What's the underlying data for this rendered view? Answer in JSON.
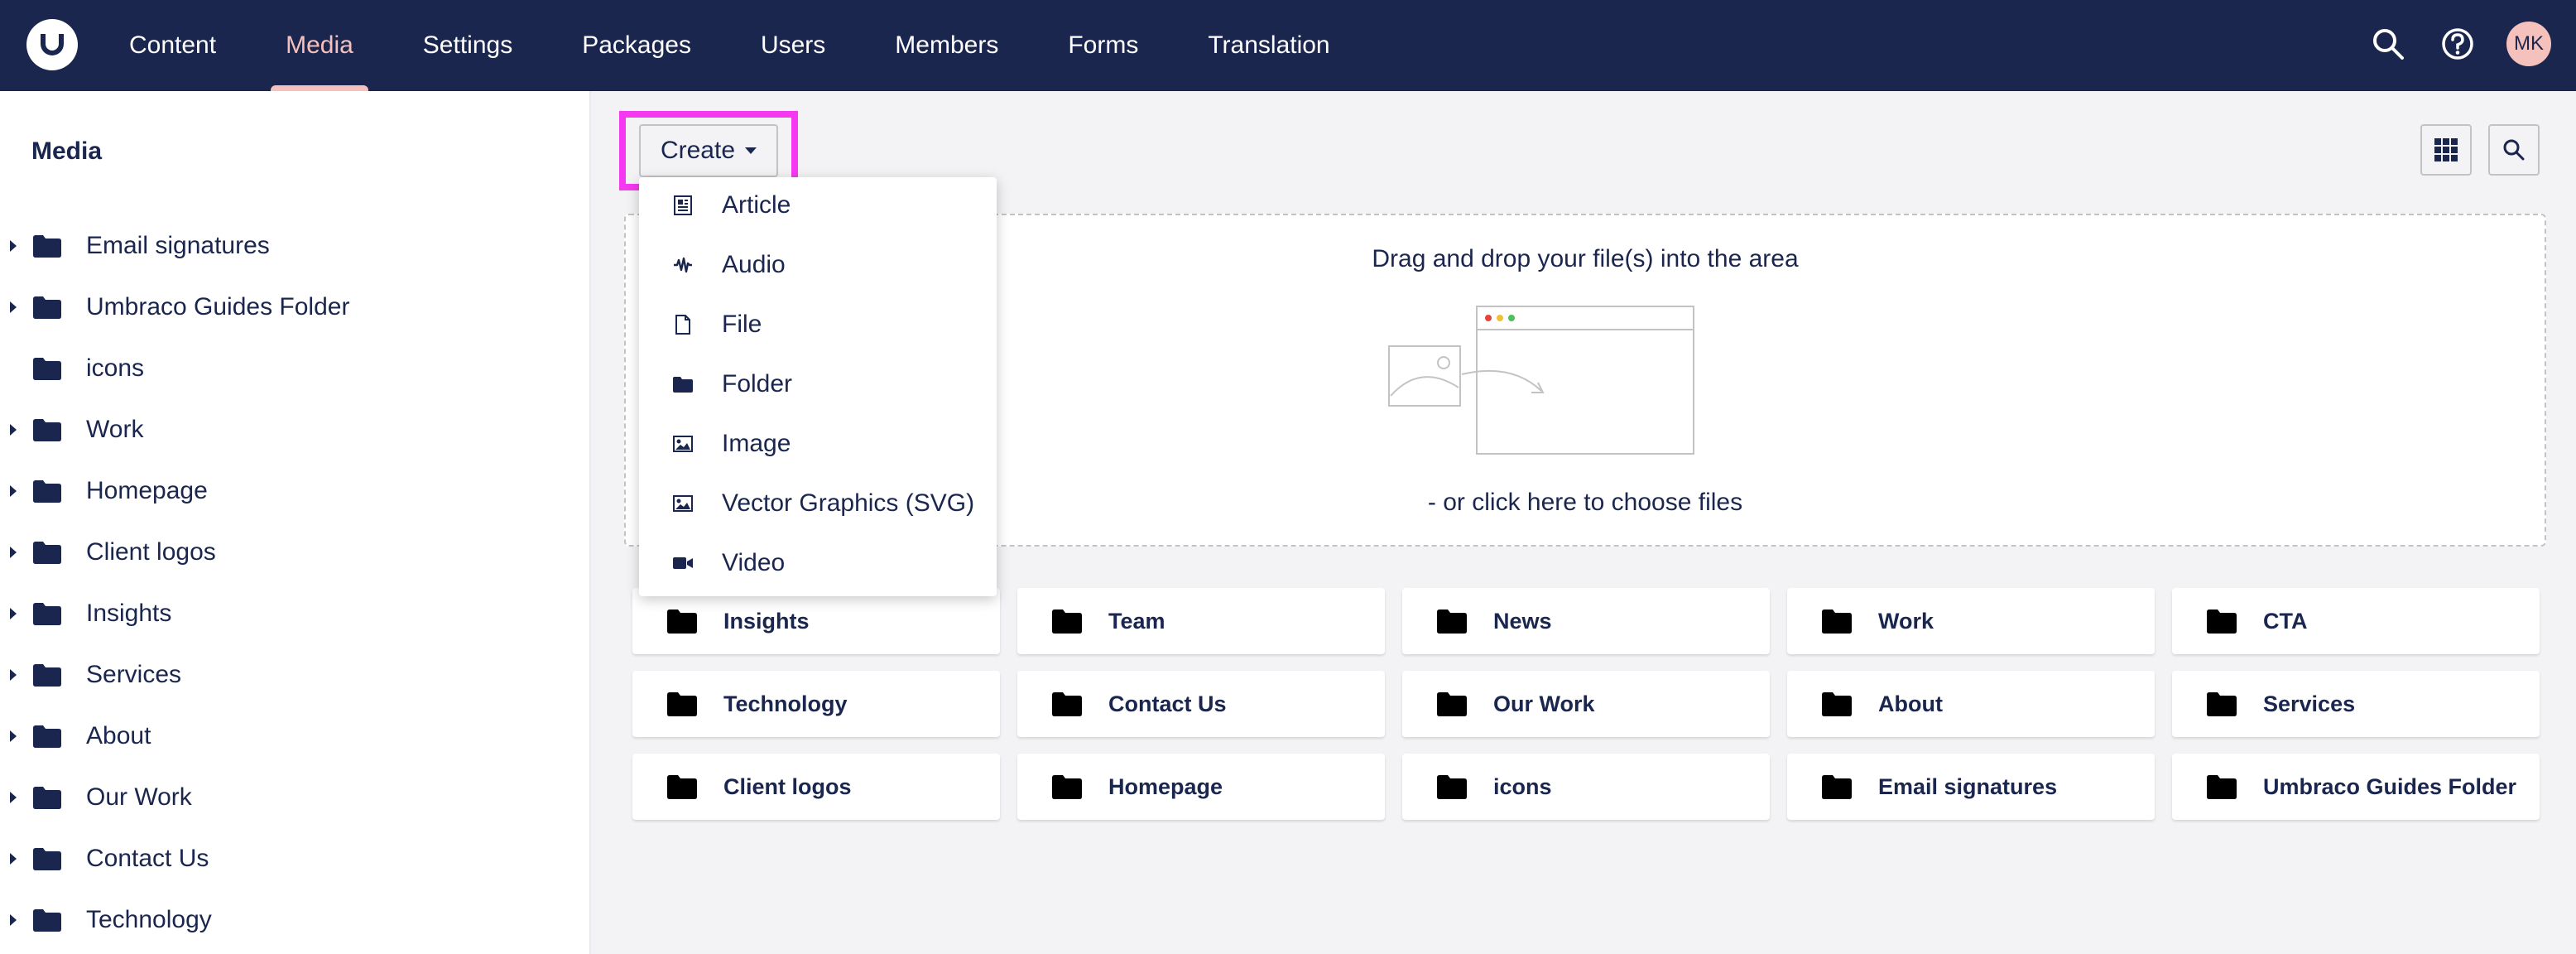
{
  "nav": {
    "items": [
      {
        "label": "Content",
        "active": false
      },
      {
        "label": "Media",
        "active": true
      },
      {
        "label": "Settings",
        "active": false
      },
      {
        "label": "Packages",
        "active": false
      },
      {
        "label": "Users",
        "active": false
      },
      {
        "label": "Members",
        "active": false
      },
      {
        "label": "Forms",
        "active": false
      },
      {
        "label": "Translation",
        "active": false
      }
    ],
    "avatar_initials": "MK"
  },
  "sidebar": {
    "title": "Media",
    "items": [
      {
        "label": "Email signatures",
        "has_children": true
      },
      {
        "label": "Umbraco Guides Folder",
        "has_children": true
      },
      {
        "label": "icons",
        "has_children": false
      },
      {
        "label": "Work",
        "has_children": true
      },
      {
        "label": "Homepage",
        "has_children": true
      },
      {
        "label": "Client logos",
        "has_children": true
      },
      {
        "label": "Insights",
        "has_children": true
      },
      {
        "label": "Services",
        "has_children": true
      },
      {
        "label": "About",
        "has_children": true
      },
      {
        "label": "Our Work",
        "has_children": true
      },
      {
        "label": "Contact Us",
        "has_children": true
      },
      {
        "label": "Technology",
        "has_children": true
      }
    ]
  },
  "toolbar": {
    "create_label": "Create"
  },
  "create_menu": {
    "items": [
      {
        "label": "Article",
        "icon": "article-icon"
      },
      {
        "label": "Audio",
        "icon": "audio-icon"
      },
      {
        "label": "File",
        "icon": "file-icon"
      },
      {
        "label": "Folder",
        "icon": "folder-icon"
      },
      {
        "label": "Image",
        "icon": "image-icon"
      },
      {
        "label": "Vector Graphics (SVG)",
        "icon": "image-icon"
      },
      {
        "label": "Video",
        "icon": "video-icon"
      }
    ]
  },
  "dropzone": {
    "drag_text": "Drag and drop your file(s) into the area",
    "click_text": "- or click here to choose files"
  },
  "folders": [
    "Insights",
    "Team",
    "News",
    "Work",
    "CTA",
    "Technology",
    "Contact Us",
    "Our Work",
    "About",
    "Services",
    "Client logos",
    "Homepage",
    "icons",
    "Email signatures",
    "Umbraco Guides Folder"
  ],
  "colors": {
    "header_bg": "#1b264f",
    "active_accent": "#f5c1bc",
    "highlight": "#f539f0",
    "main_bg": "#f3f3f5"
  }
}
